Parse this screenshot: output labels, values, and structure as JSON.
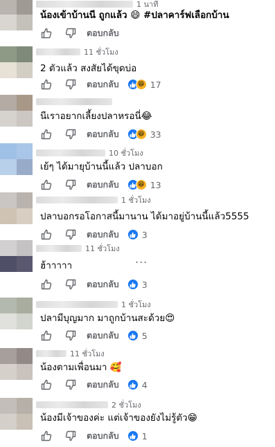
{
  "comments": [
    {
      "time": "1 นาที",
      "text": "น้องเข้าบ้านนี ถูกแล้ว 😄 #ปลาคาร์ฟเลือกบ้าน",
      "reply_label": "ตอบกลับ",
      "reaction_count": ""
    },
    {
      "time": "11 ชั่วโมง",
      "text": "2 ตัวแล้ว สงสัยได้ขุดบ่อ",
      "reply_label": "ตอบกลับ",
      "reaction_count": "17"
    },
    {
      "time": "",
      "text": "นีเราอยากเลี้ยงปลาหรอนี่😂",
      "reply_label": "ตอบกลับ",
      "reaction_count": "33"
    },
    {
      "time": "10 ชั่วโมง",
      "text": "เย้ๆ ได้มายุบ้านนี้แล้ว ปลาบอก",
      "reply_label": "ตอบกลับ",
      "reaction_count": "13"
    },
    {
      "time": "1 ชั่วโมง",
      "text": "ปลาบอกรอโอกาสนี้มานาน ได้มาอยู่บ้านนี้แล้ว5555",
      "reply_label": "ตอบกลับ",
      "reaction_count": "3"
    },
    {
      "time": "11 ชั่วโมง",
      "text": "ฮ้าาาาา",
      "reply_label": "ตอบกลับ",
      "reaction_count": "3",
      "more": "..."
    },
    {
      "time": "1 ชั่วโมง",
      "text": "ปลามีบุญมาก มาถูกบ้านสะด้วย😍",
      "reply_label": "ตอบกลับ",
      "reaction_count": "5"
    },
    {
      "time": "11 ชั่วโมง",
      "text": "น้องตามเพื่อนมา 🥰",
      "reply_label": "ตอบกลับ",
      "reaction_count": "4"
    },
    {
      "time": "2 ชั่วโมง",
      "text": "น้องมีเจ้าของค่ะ แต่เจ้าของยังไม่รู้ตัว😁",
      "reply_label": "ตอบกลับ",
      "reaction_count": "1"
    }
  ],
  "colors": {
    "like_blue": "#1877f2",
    "haha_yellow": "#f7b125",
    "meta_gray": "#65676b",
    "text": "#050505"
  },
  "icons": {
    "like": "thumbs-up-icon",
    "dislike": "thumbs-down-icon",
    "reaction_like": "like-reaction-icon",
    "reaction_haha": "haha-reaction-icon",
    "more": "more-dots-icon"
  }
}
